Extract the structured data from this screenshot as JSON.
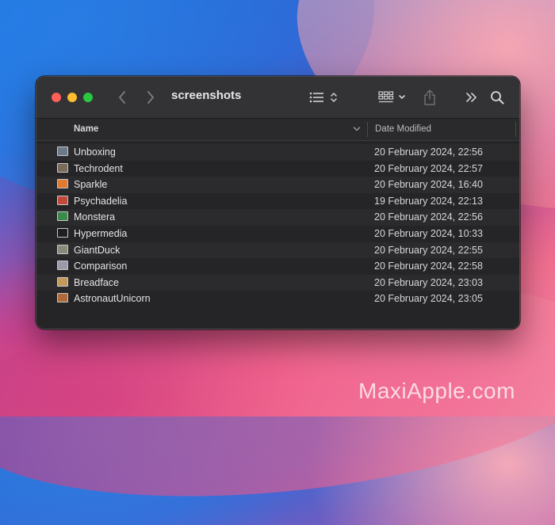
{
  "window": {
    "title": "screenshots"
  },
  "columns": {
    "name": "Name",
    "date": "Date Modified"
  },
  "files": [
    {
      "name": "Unboxing",
      "date": "20 February 2024, 22:56",
      "thumb": "#6a7a8a"
    },
    {
      "name": "Techrodent",
      "date": "20 February 2024, 22:57",
      "thumb": "#7a6a5a"
    },
    {
      "name": "Sparkle",
      "date": "20 February 2024, 16:40",
      "thumb": "#e07a30"
    },
    {
      "name": "Psychadelia",
      "date": "19 February 2024, 22:13",
      "thumb": "#c04a3a"
    },
    {
      "name": "Monstera",
      "date": "20 February 2024, 22:56",
      "thumb": "#3a8a4a"
    },
    {
      "name": "Hypermedia",
      "date": "20 February 2024, 10:33",
      "thumb": "#202020"
    },
    {
      "name": "GiantDuck",
      "date": "20 February 2024, 22:55",
      "thumb": "#8a8a7a"
    },
    {
      "name": "Comparison",
      "date": "20 February 2024, 22:58",
      "thumb": "#9a9aa8"
    },
    {
      "name": "Breadface",
      "date": "20 February 2024, 23:03",
      "thumb": "#c49a5a"
    },
    {
      "name": "AstronautUnicorn",
      "date": "20 February 2024, 23:05",
      "thumb": "#b06a3a"
    }
  ],
  "watermark": "MaxiApple.com"
}
